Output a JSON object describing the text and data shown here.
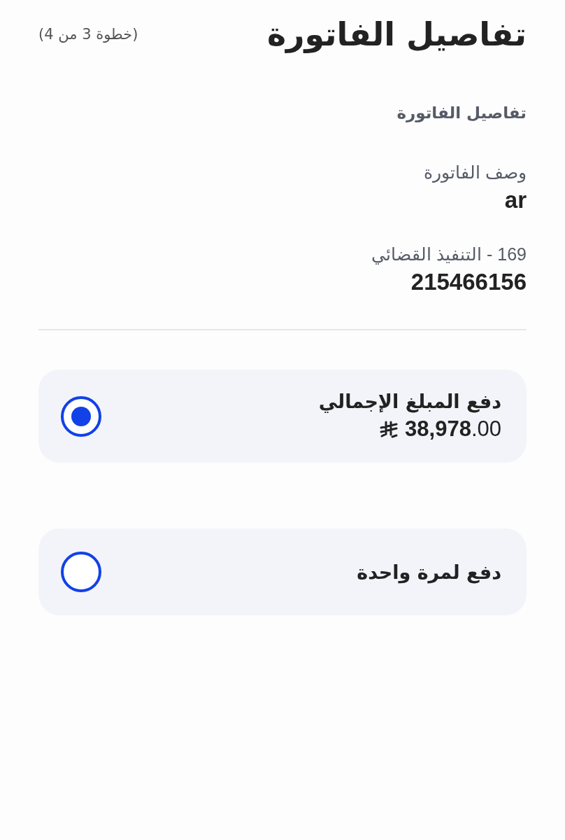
{
  "header": {
    "title": "تفاصيل الفاتورة",
    "step": "(خطوة 3 من 4)"
  },
  "section": {
    "title": "تفاصيل الفاتورة",
    "fields": [
      {
        "label": "وصف الفاتورة",
        "value": "ar"
      },
      {
        "label": "169 - التنفيذ القضائي",
        "value": "215466156"
      }
    ]
  },
  "options": [
    {
      "label": "دفع المبلغ الإجمالي",
      "amount": "**38,978**.00",
      "selected": true
    },
    {
      "label": "دفع لمرة واحدة",
      "selected": false
    }
  ]
}
